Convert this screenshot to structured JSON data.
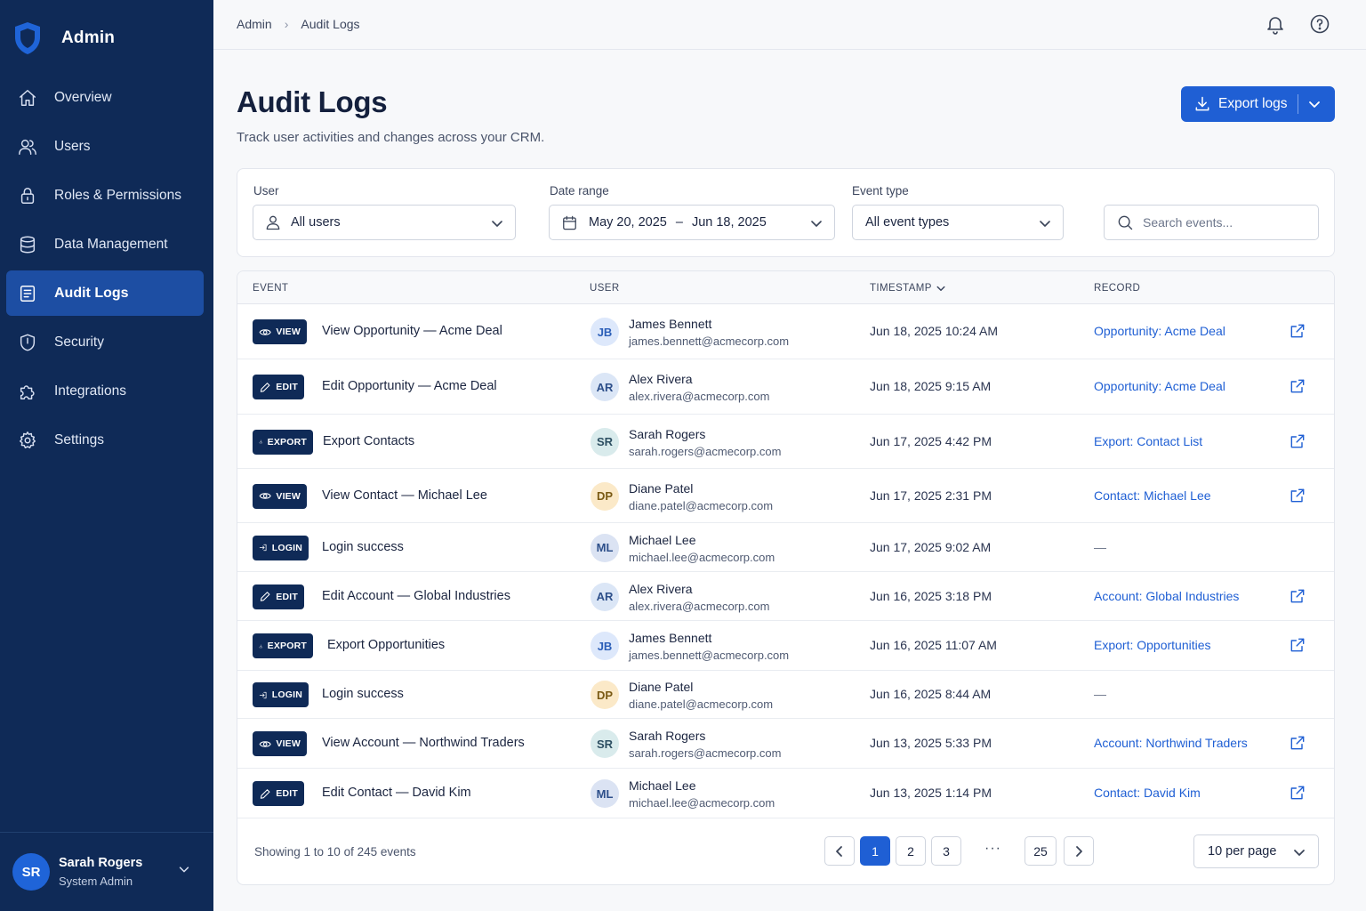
{
  "sidebar": {
    "brand": "Admin",
    "items": [
      {
        "label": "Overview",
        "icon": "home-icon"
      },
      {
        "label": "Users",
        "icon": "users-icon"
      },
      {
        "label": "Roles & Permissions",
        "icon": "lock-icon"
      },
      {
        "label": "Data Management",
        "icon": "database-icon"
      },
      {
        "label": "Audit Logs",
        "icon": "document-icon",
        "active": true
      },
      {
        "label": "Security",
        "icon": "shield-icon"
      },
      {
        "label": "Integrations",
        "icon": "puzzle-icon"
      },
      {
        "label": "Settings",
        "icon": "gear-icon"
      }
    ],
    "user": {
      "initials": "SR",
      "name": "Sarah Rogers",
      "role": "System Admin"
    }
  },
  "breadcrumb": [
    "Admin",
    "Audit Logs"
  ],
  "header": {
    "title": "Audit Logs",
    "subtitle": "Track user activities and changes across your CRM.",
    "export_label": "Export logs"
  },
  "filters": {
    "user_label": "User",
    "user_value": "All users",
    "date_label": "Date range",
    "date_start": "May 20, 2025",
    "date_sep": "–",
    "date_end": "Jun 18, 2025",
    "event_label": "Event type",
    "event_value": "All event types",
    "search_placeholder": "Search events..."
  },
  "table": {
    "columns": [
      "EVENT",
      "USER",
      "TIMESTAMP",
      "RECORD"
    ],
    "rows": [
      {
        "type": "VIEW",
        "event": "View Opportunity — Acme Deal",
        "initials": "JB",
        "user": "James Bennett",
        "email": "james.bennett@acmecorp.com",
        "timestamp": "Jun 18, 2025 10:24 AM",
        "record": "Opportunity: Acme Deal"
      },
      {
        "type": "EDIT",
        "event": "Edit Opportunity — Acme Deal",
        "initials": "AR",
        "user": "Alex Rivera",
        "email": "alex.rivera@acmecorp.com",
        "timestamp": "Jun 18, 2025 9:15 AM",
        "record": "Opportunity: Acme Deal"
      },
      {
        "type": "EXPORT",
        "event": "Export Contacts",
        "initials": "SR",
        "user": "Sarah Rogers",
        "email": "sarah.rogers@acmecorp.com",
        "timestamp": "Jun 17, 2025 4:42 PM",
        "record": "Export: Contact List"
      },
      {
        "type": "VIEW",
        "event": "View Contact — Michael Lee",
        "initials": "DP",
        "user": "Diane Patel",
        "email": "diane.patel@acmecorp.com",
        "timestamp": "Jun 17, 2025 2:31 PM",
        "record": "Contact: Michael Lee"
      },
      {
        "type": "LOGIN",
        "event": "Login success",
        "initials": "ML",
        "user": "Michael Lee",
        "email": "michael.lee@acmecorp.com",
        "timestamp": "Jun 17, 2025 9:02 AM",
        "record": "—"
      },
      {
        "type": "EDIT",
        "event": "Edit Account — Global Industries",
        "initials": "AR",
        "user": "Alex Rivera",
        "email": "alex.rivera@acmecorp.com",
        "timestamp": "Jun 16, 2025 3:18 PM",
        "record": "Account: Global Industries"
      },
      {
        "type": "EXPORT",
        "event": "Export Opportunities",
        "initials": "JB",
        "user": "James Bennett",
        "email": "james.bennett@acmecorp.com",
        "timestamp": "Jun 16, 2025 11:07 AM",
        "record": "Export: Opportunities"
      },
      {
        "type": "LOGIN",
        "event": "Login success",
        "initials": "DP",
        "user": "Diane Patel",
        "email": "diane.patel@acmecorp.com",
        "timestamp": "Jun 16, 2025 8:44 AM",
        "record": "—"
      },
      {
        "type": "VIEW",
        "event": "View Account — Northwind Traders",
        "initials": "SR",
        "user": "Sarah Rogers",
        "email": "sarah.rogers@acmecorp.com",
        "timestamp": "Jun 13, 2025 5:33 PM",
        "record": "Account: Northwind Traders"
      },
      {
        "type": "EDIT",
        "event": "Edit Contact — David Kim",
        "initials": "ML",
        "user": "Michael Lee",
        "email": "michael.lee@acmecorp.com",
        "timestamp": "Jun 13, 2025 1:14 PM",
        "record": "Contact: David Kim"
      }
    ]
  },
  "pagination": {
    "showing": "Showing 1 to 10 of 245 events",
    "pages": [
      "1",
      "2",
      "3"
    ],
    "ellipsis": "···",
    "last_page": "25",
    "per_page": "10 per page"
  },
  "colors": {
    "sidebar_bg": "#0f2a57",
    "accent": "#1f5fd4",
    "avatar_jb": "#dde8fb",
    "avatar_ar": "#dbe6f6",
    "avatar_sr": "#d9ebec",
    "avatar_dp": "#fbe9c8",
    "avatar_ml": "#dbe3f3"
  }
}
